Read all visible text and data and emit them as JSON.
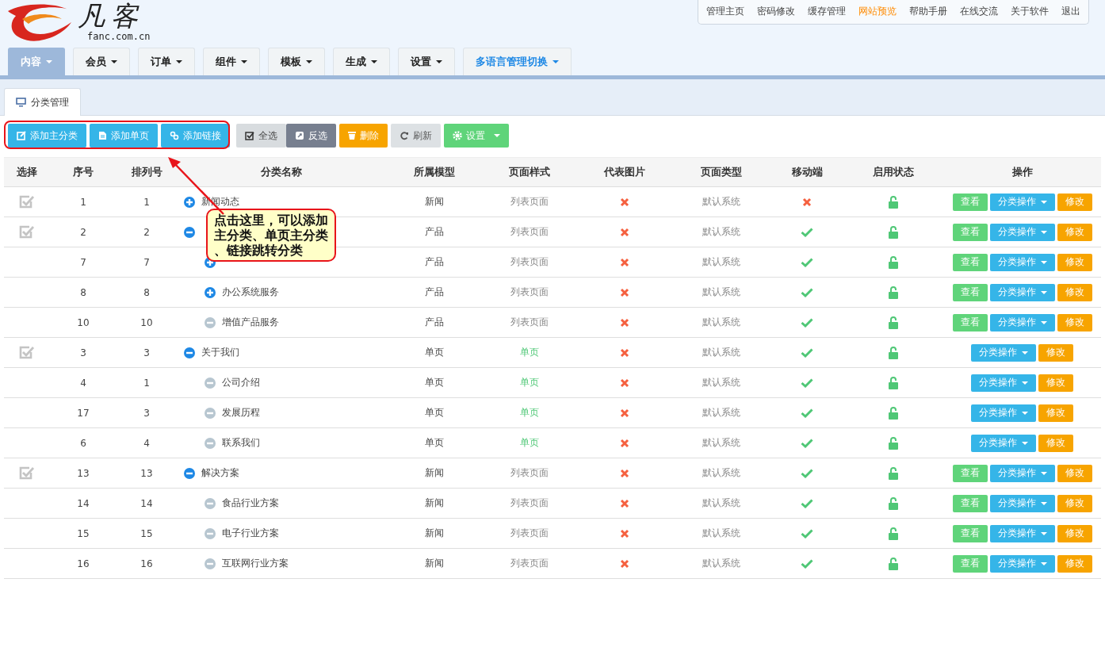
{
  "logo": {
    "name": "凡客",
    "domain": "fanc.com.cn"
  },
  "top_links": [
    {
      "label": "管理主页",
      "accent": false
    },
    {
      "label": "密码修改",
      "accent": false
    },
    {
      "label": "缓存管理",
      "accent": false
    },
    {
      "label": "网站预览",
      "accent": true
    },
    {
      "label": "帮助手册",
      "accent": false
    },
    {
      "label": "在线交流",
      "accent": false
    },
    {
      "label": "关于软件",
      "accent": false
    },
    {
      "label": "退出",
      "accent": false
    }
  ],
  "nav_tabs": [
    {
      "label": "内容",
      "selected": true,
      "accent": false
    },
    {
      "label": "会员",
      "selected": false,
      "accent": false
    },
    {
      "label": "订单",
      "selected": false,
      "accent": false
    },
    {
      "label": "组件",
      "selected": false,
      "accent": false
    },
    {
      "label": "模板",
      "selected": false,
      "accent": false
    },
    {
      "label": "生成",
      "selected": false,
      "accent": false
    },
    {
      "label": "设置",
      "selected": false,
      "accent": false
    },
    {
      "label": "多语言管理切换",
      "selected": false,
      "accent": true
    }
  ],
  "page_tab": {
    "label": "分类管理",
    "selected": true
  },
  "toolbar": [
    {
      "label": "添加主分类",
      "kind": "add-category"
    },
    {
      "label": "添加单页",
      "kind": "add-page"
    },
    {
      "label": "添加链接",
      "kind": "add-link"
    },
    {
      "label": "全选",
      "kind": "select-all"
    },
    {
      "label": "反选",
      "kind": "invert"
    },
    {
      "label": "删除",
      "kind": "delete"
    },
    {
      "label": "刷新",
      "kind": "refresh"
    },
    {
      "label": "设置",
      "kind": "settings"
    }
  ],
  "callout": {
    "text": "点击这里，可以添加主分类、单页主分类、链接跳转分类"
  },
  "table": {
    "columns": [
      "选择",
      "序号",
      "排列号",
      "分类名称",
      "所属模型",
      "页面样式",
      "代表图片",
      "页面类型",
      "移动端",
      "启用状态",
      "操作"
    ],
    "rows": [
      {
        "checkable": true,
        "id": "1",
        "sort": "1",
        "has_children": true,
        "expanded": false,
        "name": "新闻动态",
        "model": "新闻",
        "style": "列表页面",
        "single_page": false,
        "has_image": false,
        "page_type": "默认系统",
        "mobile": false,
        "enabled": true,
        "actions": [
          {
            "label": "查看",
            "kind": "view"
          },
          {
            "label": "分类操作",
            "kind": "menu"
          },
          {
            "label": "修改",
            "kind": "edit"
          }
        ]
      },
      {
        "checkable": true,
        "id": "2",
        "sort": "2",
        "has_children": true,
        "expanded": true,
        "model": "产品",
        "style": "列表页面",
        "single_page": false,
        "has_image": false,
        "page_type": "默认系统",
        "mobile": true,
        "enabled": true,
        "actions": [
          {
            "label": "查看",
            "kind": "view"
          },
          {
            "label": "分类操作",
            "kind": "menu"
          },
          {
            "label": "修改",
            "kind": "edit"
          }
        ],
        "children": [
          {
            "checkable": false,
            "id": "7",
            "sort": "7",
            "has_children": true,
            "expanded": false,
            "model": "产品",
            "style": "列表页面",
            "single_page": false,
            "has_image": false,
            "page_type": "默认系统",
            "mobile": true,
            "enabled": true,
            "actions": [
              {
                "label": "查看",
                "kind": "view"
              },
              {
                "label": "分类操作",
                "kind": "menu"
              },
              {
                "label": "修改",
                "kind": "edit"
              }
            ]
          },
          {
            "checkable": false,
            "id": "8",
            "sort": "8",
            "has_children": true,
            "expanded": false,
            "name": "办公系统服务",
            "model": "产品",
            "style": "列表页面",
            "single_page": false,
            "has_image": false,
            "page_type": "默认系统",
            "mobile": true,
            "enabled": true,
            "actions": [
              {
                "label": "查看",
                "kind": "view"
              },
              {
                "label": "分类操作",
                "kind": "menu"
              },
              {
                "label": "修改",
                "kind": "edit"
              }
            ]
          },
          {
            "checkable": false,
            "id": "10",
            "sort": "10",
            "has_children": false,
            "name": "增值产品服务",
            "model": "产品",
            "style": "列表页面",
            "single_page": false,
            "has_image": false,
            "page_type": "默认系统",
            "mobile": true,
            "enabled": true,
            "actions": [
              {
                "label": "查看",
                "kind": "view"
              },
              {
                "label": "分类操作",
                "kind": "menu"
              },
              {
                "label": "修改",
                "kind": "edit"
              }
            ]
          }
        ]
      },
      {
        "checkable": true,
        "id": "3",
        "sort": "3",
        "has_children": true,
        "expanded": true,
        "name": "关于我们",
        "model": "单页",
        "style": "单页",
        "single_page": true,
        "has_image": false,
        "page_type": "默认系统",
        "mobile": true,
        "enabled": true,
        "actions": [
          {
            "label": "分类操作",
            "kind": "menu"
          },
          {
            "label": "修改",
            "kind": "edit"
          }
        ],
        "children": [
          {
            "checkable": false,
            "id": "4",
            "sort": "1",
            "has_children": false,
            "name": "公司介绍",
            "model": "单页",
            "style": "单页",
            "single_page": true,
            "has_image": false,
            "page_type": "默认系统",
            "mobile": true,
            "enabled": true,
            "actions": [
              {
                "label": "分类操作",
                "kind": "menu"
              },
              {
                "label": "修改",
                "kind": "edit"
              }
            ]
          },
          {
            "checkable": false,
            "id": "17",
            "sort": "3",
            "has_children": false,
            "name": "发展历程",
            "model": "单页",
            "style": "单页",
            "single_page": true,
            "has_image": false,
            "page_type": "默认系统",
            "mobile": true,
            "enabled": true,
            "actions": [
              {
                "label": "分类操作",
                "kind": "menu"
              },
              {
                "label": "修改",
                "kind": "edit"
              }
            ]
          },
          {
            "checkable": false,
            "id": "6",
            "sort": "4",
            "has_children": false,
            "name": "联系我们",
            "model": "单页",
            "style": "单页",
            "single_page": true,
            "has_image": false,
            "page_type": "默认系统",
            "mobile": true,
            "enabled": true,
            "actions": [
              {
                "label": "分类操作",
                "kind": "menu"
              },
              {
                "label": "修改",
                "kind": "edit"
              }
            ]
          }
        ]
      },
      {
        "checkable": true,
        "id": "13",
        "sort": "13",
        "has_children": true,
        "expanded": true,
        "name": "解决方案",
        "model": "新闻",
        "style": "列表页面",
        "single_page": false,
        "has_image": false,
        "page_type": "默认系统",
        "mobile": true,
        "enabled": true,
        "actions": [
          {
            "label": "查看",
            "kind": "view"
          },
          {
            "label": "分类操作",
            "kind": "menu"
          },
          {
            "label": "修改",
            "kind": "edit"
          }
        ],
        "children": [
          {
            "checkable": false,
            "id": "14",
            "sort": "14",
            "has_children": false,
            "name": "食品行业方案",
            "model": "新闻",
            "style": "列表页面",
            "single_page": false,
            "has_image": false,
            "page_type": "默认系统",
            "mobile": true,
            "enabled": true,
            "actions": [
              {
                "label": "查看",
                "kind": "view"
              },
              {
                "label": "分类操作",
                "kind": "menu"
              },
              {
                "label": "修改",
                "kind": "edit"
              }
            ]
          },
          {
            "checkable": false,
            "id": "15",
            "sort": "15",
            "has_children": false,
            "name": "电子行业方案",
            "model": "新闻",
            "style": "列表页面",
            "single_page": false,
            "has_image": false,
            "page_type": "默认系统",
            "mobile": true,
            "enabled": true,
            "actions": [
              {
                "label": "查看",
                "kind": "view"
              },
              {
                "label": "分类操作",
                "kind": "menu"
              },
              {
                "label": "修改",
                "kind": "edit"
              }
            ]
          },
          {
            "checkable": false,
            "id": "16",
            "sort": "16",
            "has_children": false,
            "name": "互联网行业方案",
            "model": "新闻",
            "style": "列表页面",
            "single_page": false,
            "has_image": false,
            "page_type": "默认系统",
            "mobile": true,
            "enabled": true,
            "actions": [
              {
                "label": "查看",
                "kind": "view"
              },
              {
                "label": "分类操作",
                "kind": "menu"
              },
              {
                "label": "修改",
                "kind": "edit"
              }
            ]
          }
        ]
      }
    ]
  }
}
